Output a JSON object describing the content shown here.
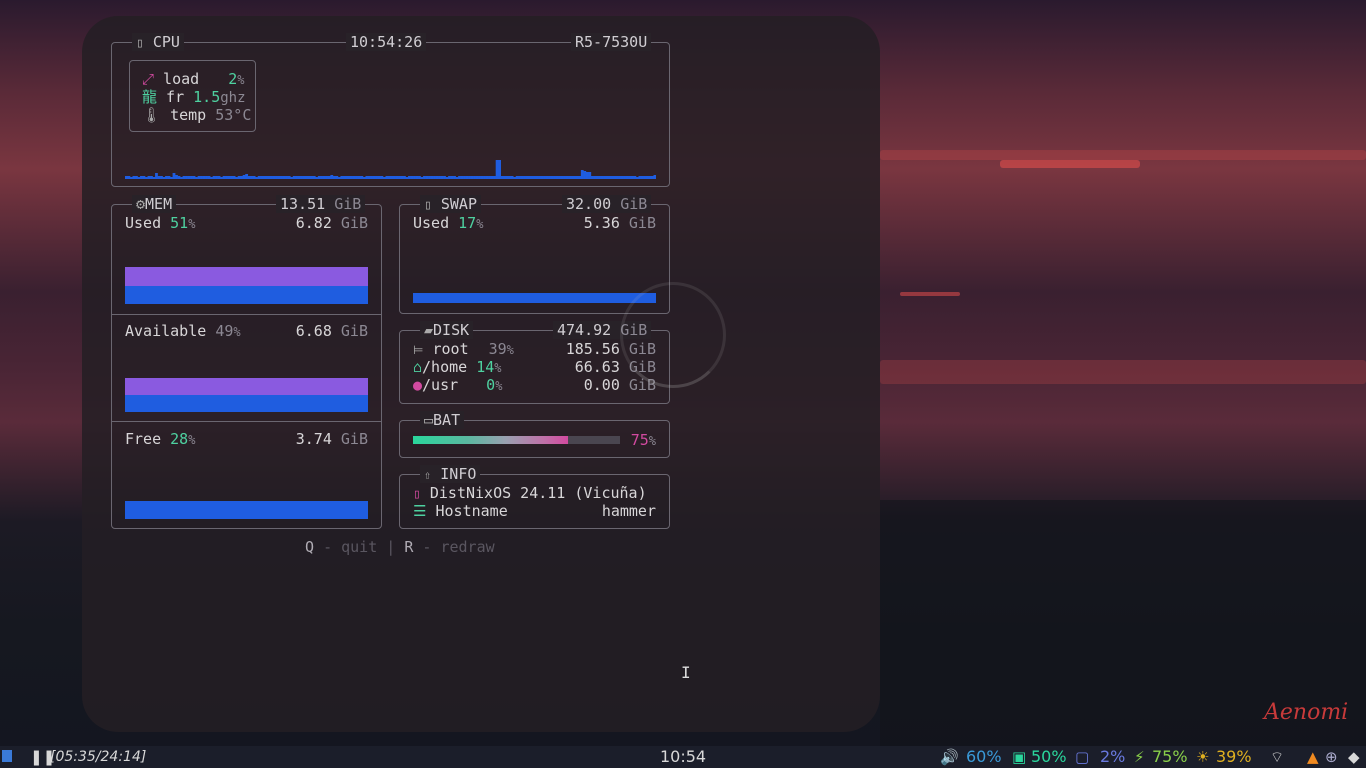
{
  "cpu": {
    "title": "CPU",
    "clock": "10:54:26",
    "model": "R5-7530U",
    "load_label": "load",
    "load_value": "2",
    "freq_label": "fr",
    "freq_value": "1.5",
    "freq_unit": "ghz",
    "temp_label": "temp",
    "temp_value": "53°C",
    "graph": [
      3,
      3,
      2,
      3,
      3,
      2,
      3,
      3,
      2,
      3,
      3,
      2,
      6,
      3,
      3,
      2,
      3,
      3,
      2,
      6,
      4,
      3,
      2,
      3,
      3,
      3,
      3,
      3,
      2,
      3,
      3,
      3,
      3,
      3,
      2,
      3,
      3,
      3,
      2,
      3,
      3,
      3,
      3,
      3,
      2,
      3,
      3,
      4,
      5,
      3,
      3,
      3,
      2,
      3,
      3,
      3,
      3,
      3,
      3,
      3,
      3,
      3,
      3,
      3,
      3,
      3,
      2,
      3,
      3,
      3,
      3,
      3,
      3,
      3,
      3,
      3,
      2,
      3,
      3,
      3,
      3,
      3,
      4,
      3,
      3,
      2,
      3,
      3,
      3,
      3,
      3,
      3,
      3,
      3,
      3,
      2,
      3,
      3,
      3,
      3,
      3,
      3,
      3,
      2,
      3,
      3,
      3,
      3,
      3,
      3,
      3,
      3,
      2,
      3,
      3,
      3,
      3,
      3,
      2,
      3,
      3,
      3,
      3,
      3,
      3,
      3,
      3,
      3,
      2,
      3,
      3,
      3,
      2,
      3,
      3,
      3,
      3,
      3,
      3,
      3,
      3,
      3,
      3,
      3,
      3,
      3,
      3,
      3,
      19,
      19,
      3,
      3,
      3,
      3,
      3,
      2,
      3,
      3,
      3,
      3,
      3,
      3,
      3,
      3,
      3,
      3,
      3,
      3,
      3,
      3,
      3,
      3,
      3,
      3,
      3,
      3,
      3,
      3,
      3,
      3,
      3,
      3,
      9,
      8,
      7,
      7,
      3,
      3,
      3,
      3,
      3,
      3,
      3,
      3,
      3,
      3,
      3,
      3,
      3,
      3,
      3,
      3,
      3,
      3,
      2,
      3,
      3,
      3,
      3,
      3,
      3,
      4
    ]
  },
  "mem": {
    "title": "MEM",
    "total": "13.51",
    "unit": "GiB",
    "used_label": "Used",
    "used_pct": "51",
    "used_value": "6.82",
    "avail_label": "Available",
    "avail_pct": "49",
    "avail_value": "6.68",
    "free_label": "Free",
    "free_pct": "28",
    "free_value": "3.74"
  },
  "swap": {
    "title": "SWAP",
    "total": "32.00",
    "unit": "GiB",
    "used_label": "Used",
    "used_pct": "17",
    "used_value": "5.36"
  },
  "disk": {
    "title": "DISK",
    "total": "474.92",
    "unit": "GiB",
    "rows": [
      {
        "name": "root",
        "pct": "39",
        "value": "185.56"
      },
      {
        "name": "/home",
        "pct": "14",
        "value": "66.63"
      },
      {
        "name": "/usr",
        "pct": "0",
        "value": "0.00"
      }
    ]
  },
  "bat": {
    "title": "BAT",
    "pct": "75",
    "level": 0.75
  },
  "info": {
    "title": "INFO",
    "os": "DistNixOS 24.11 (Vicuña)",
    "hostname_label": "Hostname",
    "hostname": "hammer"
  },
  "footer": {
    "q": "Q",
    "quit": "quit",
    "sep": "|",
    "r": "R",
    "redraw": "redraw",
    "dash": "-"
  },
  "statusbar": {
    "timer": "[05:35/24:14]",
    "clock": "10:54",
    "volume": "60%",
    "cpu": "50%",
    "mem": "2%",
    "battery": "75%",
    "brightness": "39%"
  },
  "signature": "Aenomi",
  "colors": {
    "accent_green": "#4ed1a0",
    "bar_blue": "#1f5de0",
    "bar_purple": "#8a5ae0",
    "bat_pink": "#d24aa0"
  }
}
